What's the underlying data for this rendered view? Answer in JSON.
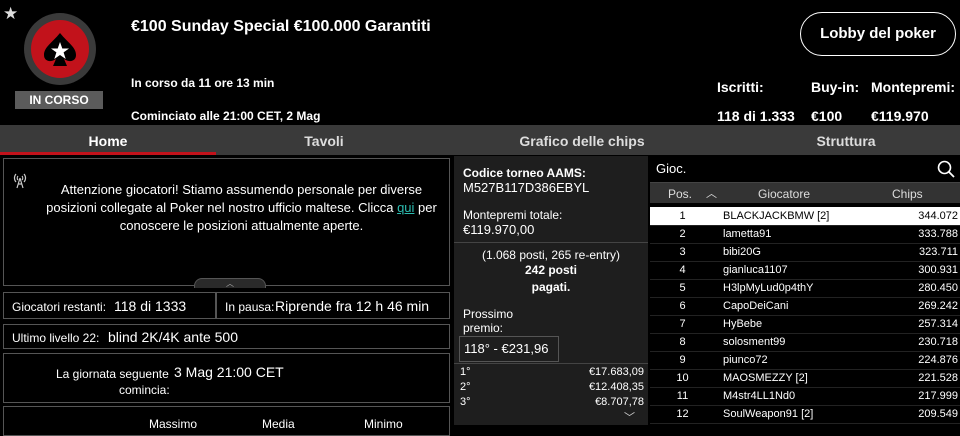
{
  "header": {
    "title": "€100 Sunday Special €100.000 Garantiti",
    "status": "IN CORSO",
    "running_for": "In corso da 11 ore 13 min",
    "started_at": "Cominciato alle 21:00 CET, 2 Mag",
    "lobby_button": "Lobby del poker",
    "stats": {
      "entrants_label": "Iscritti:",
      "entrants_value": "118 di 1.333",
      "buyin_label": "Buy-in:",
      "buyin_value": "€100",
      "prize_label": "Montepremi:",
      "prize_value": "€119.970"
    }
  },
  "tabs": [
    "Home",
    "Tavoli",
    "Grafico delle chips",
    "Struttura"
  ],
  "notice": {
    "text_before": "Attenzione giocatori! Stiamo assumendo personale per diverse posizioni collegate al Poker nel nostro ufficio maltese. Clicca ",
    "link": "qui",
    "text_after": " per conoscere le posizioni attualmente aperte."
  },
  "info": {
    "remaining_label": "Giocatori restanti:",
    "remaining_value": "118 di 1333",
    "pause_label": "In pausa:",
    "pause_value": "Riprende fra 12 h 46 min",
    "level_label": "Ultimo livello 22:",
    "level_value": "blind 2K/4K ante 500",
    "nextday_label_1": "La giornata seguente",
    "nextday_label_2": "comincia:",
    "nextday_value": "3 Mag 21:00 CET",
    "col_max": "Massimo",
    "col_avg": "Media",
    "col_min": "Minimo"
  },
  "middle": {
    "code_label": "Codice torneo AAMS:",
    "code_value": "M527B117D386EBYL",
    "total_label": "Montepremi totale:",
    "total_value": "€119.970,00",
    "places_1": "(1.068 posti, 265 re-entry)",
    "places_2": "242 posti",
    "places_3": "pagati.",
    "next_label_1": "Prossimo",
    "next_label_2": "premio:",
    "next_value": "118° - €231,96",
    "payouts": [
      {
        "pos": "1°",
        "amount": "€17.683,09"
      },
      {
        "pos": "2°",
        "amount": "€12.408,35"
      },
      {
        "pos": "3°",
        "amount": "€8.707,78"
      }
    ]
  },
  "players": {
    "search_placeholder": "Gioc.",
    "col_pos": "Pos.",
    "col_player": "Giocatore",
    "col_chips": "Chips",
    "rows": [
      {
        "pos": "1",
        "name": "BLACKJACKBMW [2]",
        "chips": "344.072"
      },
      {
        "pos": "2",
        "name": "lametta91",
        "chips": "333.788"
      },
      {
        "pos": "3",
        "name": "bibi20G",
        "chips": "323.711"
      },
      {
        "pos": "4",
        "name": "gianluca1107",
        "chips": "300.931"
      },
      {
        "pos": "5",
        "name": "H3lpMyLud0p4thY",
        "chips": "280.450"
      },
      {
        "pos": "6",
        "name": "CapoDeiCani",
        "chips": "269.242"
      },
      {
        "pos": "7",
        "name": "HyBebe",
        "chips": "257.314"
      },
      {
        "pos": "8",
        "name": "solosment99",
        "chips": "230.718"
      },
      {
        "pos": "9",
        "name": "piunco72",
        "chips": "224.876"
      },
      {
        "pos": "10",
        "name": "MAOSMEZZY [2]",
        "chips": "221.528"
      },
      {
        "pos": "11",
        "name": "M4str4LL1Nd0",
        "chips": "217.999"
      },
      {
        "pos": "12",
        "name": "SoulWeapon91 [2]",
        "chips": "209.549"
      }
    ]
  },
  "colors": {
    "accent": "#c2121b",
    "link": "#2dbdb1"
  }
}
